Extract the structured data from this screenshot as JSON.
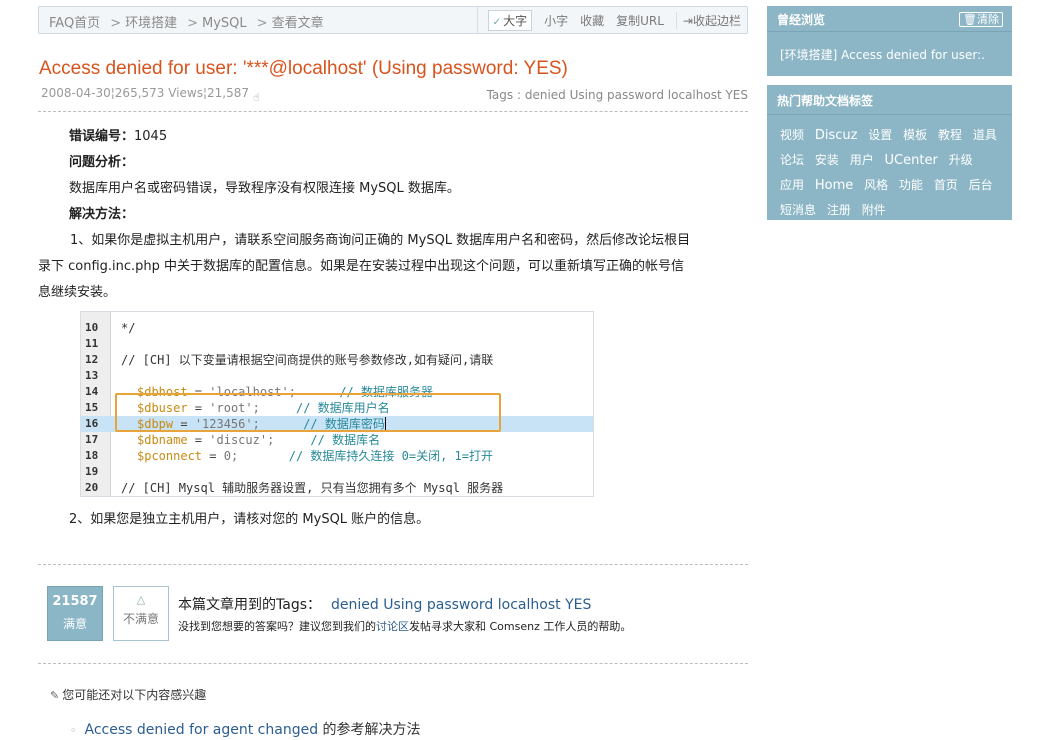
{
  "breadcrumb": [
    "FAQ首页",
    "环境搭建",
    "MySQL",
    "查看文章"
  ],
  "toolbar": {
    "big_font": "大字",
    "small_font": "小字",
    "favorite": "收藏",
    "copy_url": "复制URL",
    "collapse_sidebar": "收起边栏"
  },
  "article": {
    "title": "Access denied for user: '***@localhost' (Using password: YES)",
    "date": "2008-04-30",
    "views": "265,573 Views",
    "count": "21,587",
    "tags_label": "Tags :",
    "tags": "denied Using password localhost YES",
    "error_label": "错误编号：",
    "error_code": "1045",
    "analysis_label": "问题分析：",
    "analysis_text": "数据库用户名或密码错误，导致程序没有权限连接 MySQL 数据库。",
    "solution_label": "解决方法：",
    "solution_1_line1": "1、如果你是虚拟主机用户，请联系空间服务商询问正确的 MySQL 数据库用户名和密码，然后修改论坛根目",
    "solution_1_line2": "录下 config.inc.php 中关于数据库的配置信息。如果是在安装过程中出现这个问题，可以重新填写正确的帐号信",
    "solution_1_line3": "息继续安装。",
    "solution_2": "2、如果您是独立主机用户，请核对您的 MySQL 账户的信息。"
  },
  "code": {
    "lines": [
      {
        "num": "10",
        "text": "*/"
      },
      {
        "num": "11",
        "text": ""
      },
      {
        "num": "12",
        "text": "// [CH] 以下变量请根据空间商提供的账号参数修改,如有疑问,请联"
      },
      {
        "num": "13",
        "text": ""
      },
      {
        "num": "14",
        "var": "$dbhost",
        "val": "'localhost';",
        "comment": "// 数据库服务器"
      },
      {
        "num": "15",
        "var": "$dbuser",
        "val": "'root';",
        "comment": "// 数据库用户名"
      },
      {
        "num": "16",
        "var": "$dbpw",
        "val": "'123456';",
        "comment": "// 数据库密码"
      },
      {
        "num": "17",
        "var": "$dbname",
        "val": "'discuz';",
        "comment": "// 数据库名"
      },
      {
        "num": "18",
        "var": "$pconnect",
        "val": "0;",
        "comment": "// 数据库持久连接 0=关闭, 1=打开"
      },
      {
        "num": "19",
        "text": ""
      },
      {
        "num": "20",
        "text": "// [CH] Mysql 辅助服务器设置, 只有当您拥有多个 Mysql 服务器"
      }
    ]
  },
  "vote": {
    "yes_count": "21587",
    "yes_label": "满意",
    "no_label": "不满意",
    "tags_used_label": "本篇文章用到的Tags：",
    "tags_used": "denied Using password localhost YES",
    "help_prefix": "没找到您想要的答案吗？建议您到我们的",
    "help_link": "讨论区",
    "help_suffix": "发帖寻求大家和 Comsenz 工作人员的帮助。"
  },
  "interest": {
    "heading": "您可能还对以下内容感兴趣",
    "items": [
      {
        "link": "Access denied for agent changed",
        "suffix": " 的参考解决方法"
      }
    ]
  },
  "sidebar": {
    "history_title": "曾经浏览",
    "clear_label": "清除",
    "history_item": "[环境搭建] Access denied for user:.",
    "hot_tags_title": "热门帮助文档标签",
    "hot_tags": [
      "视频",
      "Discuz",
      "设置",
      "模板",
      "教程",
      "道具",
      "论坛",
      "安装",
      "用户",
      "UCenter",
      "升级",
      "应用",
      "Home",
      "风格",
      "功能",
      "首页",
      "后台",
      "短消息",
      "注册",
      "附件"
    ]
  },
  "colors": {
    "title": "#d9531e",
    "link": "#2b5e90",
    "sidebar_bg": "#8cb6c6",
    "highlight_line": "#c7e3f5",
    "annotation_box": "#e8a33a"
  }
}
